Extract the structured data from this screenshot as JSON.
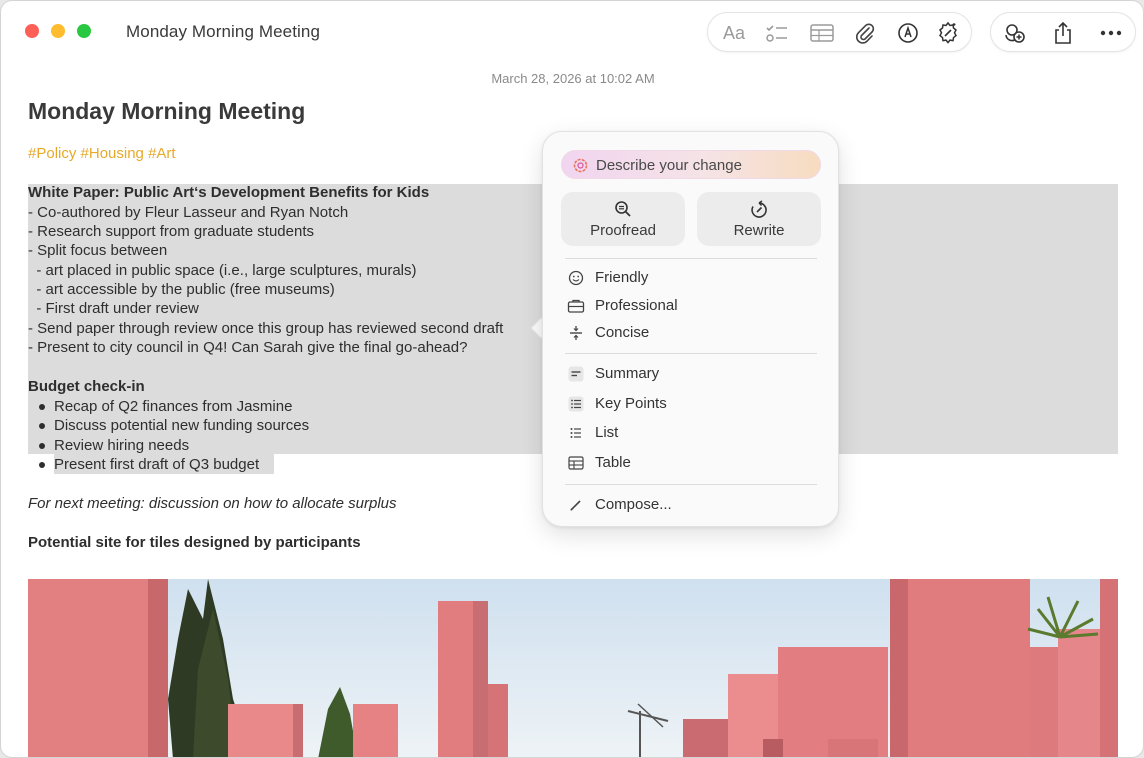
{
  "window": {
    "title": "Monday Morning Meeting"
  },
  "toolbar": {
    "format_label": "Aa",
    "icons": [
      "format-icon",
      "checklist-icon",
      "table-icon",
      "attachment-icon",
      "markup-icon",
      "writing-tools-icon",
      "collaborate-icon",
      "share-icon",
      "more-icon"
    ]
  },
  "note": {
    "timestamp": "March 28, 2026 at 10:02 AM",
    "title": "Monday Morning Meeting",
    "tags": "#Policy #Housing #Art",
    "section1_heading": "White Paper: Public Art‘s Development Benefits for Kids",
    "section1_lines": [
      "- Co-authored by Fleur Lasseur and Ryan Notch",
      "- Research support from graduate students",
      "- Split focus between",
      "  - art placed in public space (i.e., large sculptures, murals)",
      "  - art accessible by the public (free museums)",
      "  - First draft under review",
      "- Send paper through review once this group has reviewed second draft",
      "- Present to city council in Q4! Can Sarah give the final go-ahead?"
    ],
    "section2_heading": "Budget check-in",
    "bullets": [
      "Recap of Q2 finances from Jasmine",
      "Discuss potential new funding sources",
      "Review hiring needs",
      "Present first draft of Q3 budget"
    ],
    "next_meeting": "For next meeting: discussion on how to allocate surplus",
    "photo_caption": "Potential site for tiles designed by participants"
  },
  "writing_tools": {
    "describe_placeholder": "Describe your change",
    "proofread_label": "Proofread",
    "rewrite_label": "Rewrite",
    "tone_items": [
      "Friendly",
      "Professional",
      "Concise"
    ],
    "format_items": [
      "Summary",
      "Key Points",
      "List",
      "Table"
    ],
    "compose_label": "Compose..."
  },
  "colors": {
    "tag": "#e7a92a",
    "selection": "#dcdcdc",
    "close": "#fe5f57",
    "minimize": "#febc2e",
    "maximize": "#28c840"
  }
}
